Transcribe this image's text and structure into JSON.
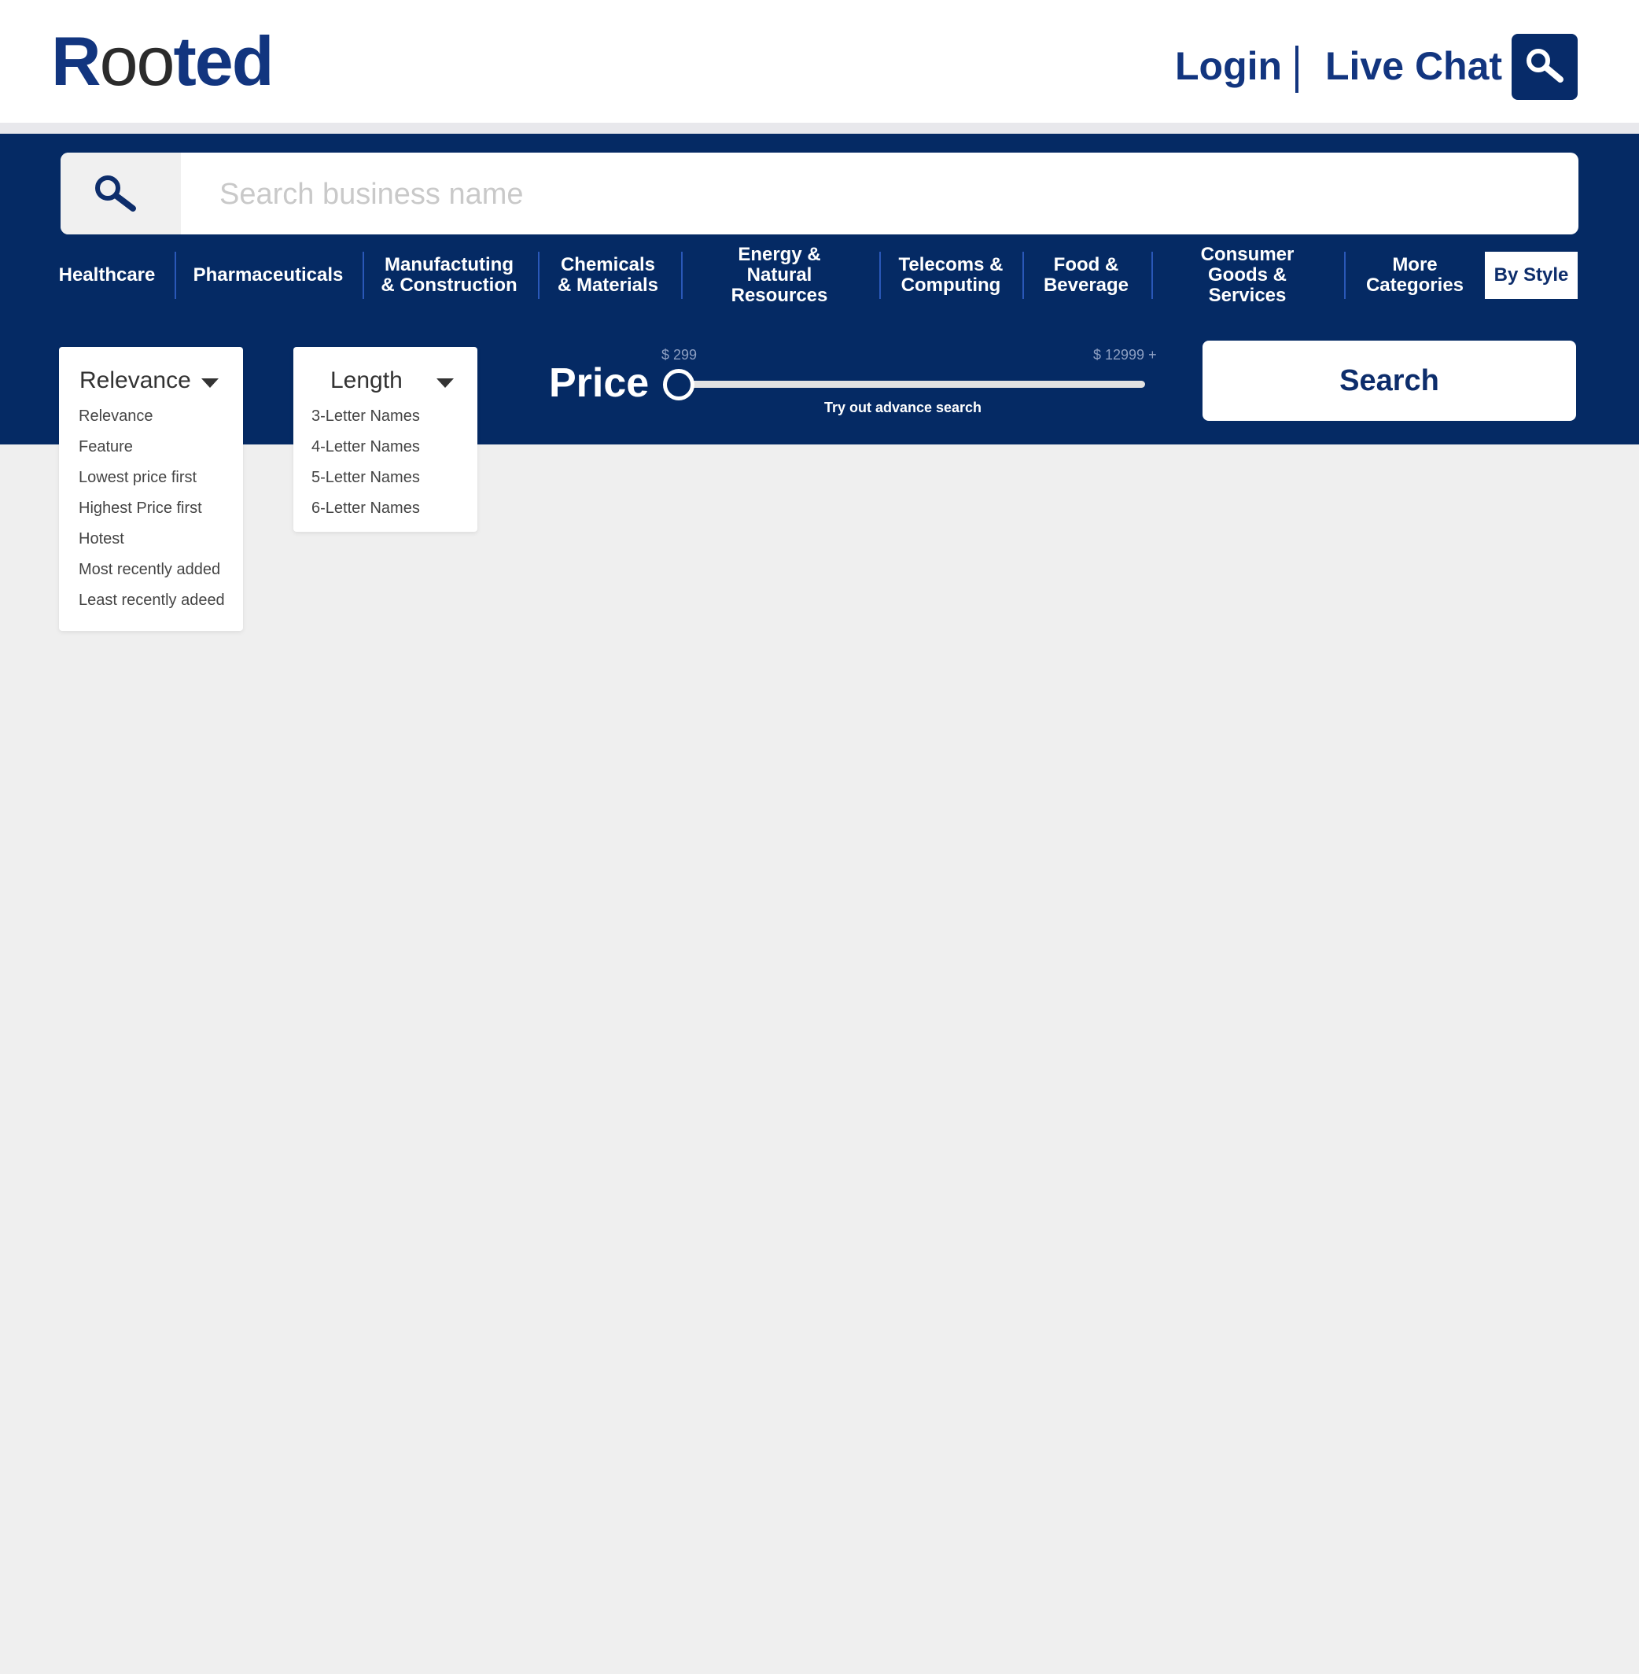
{
  "header": {
    "logo_part1": "R",
    "logo_part2": "oo",
    "logo_part3": "ted",
    "login_label": "Login",
    "separator": "|",
    "live_chat_label": "Live Chat"
  },
  "search": {
    "placeholder": "Search business name",
    "value": ""
  },
  "categories": [
    {
      "label": "Healthcare"
    },
    {
      "label": "Pharmaceuticals"
    },
    {
      "label": "Manufactuting\n& Construction"
    },
    {
      "label": "Chemicals\n& Materials"
    },
    {
      "label": "Energy &\nNatural Resources"
    },
    {
      "label": "Telecoms &\nComputing"
    },
    {
      "label": "Food &\nBeverage"
    },
    {
      "label": "Consumer\nGoods & Services"
    },
    {
      "label": "More\nCategories"
    },
    {
      "label": "By Style"
    }
  ],
  "sort_dropdown": {
    "selected": "Relevance",
    "options": [
      "Relevance",
      "Feature",
      "Lowest price first",
      "Highest Price first",
      "Hotest",
      "Most recently added",
      "Least recently adeed"
    ]
  },
  "length_dropdown": {
    "selected": "Length",
    "options": [
      "3-Letter Names",
      "4-Letter Names",
      "5-Letter Names",
      "6-Letter Names"
    ]
  },
  "price": {
    "label": "Price",
    "min_label": "$ 299",
    "max_label": "$ 12999 +",
    "slider_fraction": 0.0,
    "advance_link": "Try out advance search"
  },
  "search_button": "Search",
  "colors": {
    "brand_blue": "#12357f",
    "band_blue": "#052a64",
    "page_bg": "#efefef"
  },
  "icons": {
    "top_search": "search-icon",
    "field_search": "search-icon",
    "caret": "chevron-down-icon"
  }
}
